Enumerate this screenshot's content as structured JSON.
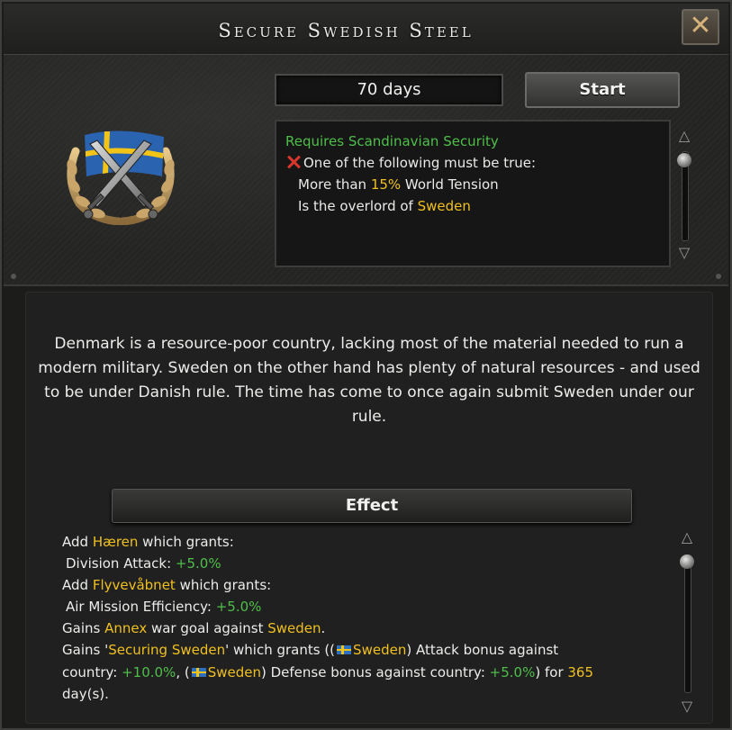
{
  "window": {
    "title": "Secure Swedish Steel",
    "close_icon": "close-x-icon",
    "close_glyph": "✕"
  },
  "focus": {
    "duration": "70 days",
    "start_label": "Start",
    "emblem_icon": "swedish-flag-crossed-swords-emblem"
  },
  "requirements": {
    "title": "Requires Scandinavian Security",
    "condition_label": "One of the following must be true:",
    "option1_prefix": "More than ",
    "option1_value": "15%",
    "option1_suffix": " World Tension",
    "option2_prefix": "Is the overlord of ",
    "option2_country": "Sweden"
  },
  "description": "Denmark is a resource-poor country, lacking most of the material needed to run a modern military. Sweden on the other hand has plenty of natural resources - and used to be under Danish rule. The time has come to once again submit Sweden under our rule.",
  "effect": {
    "header": "Effect",
    "line1_prefix": "Add ",
    "line1_name": "Hæren",
    "line1_suffix": " which grants:",
    "line2_label": "Division Attack: ",
    "line2_value": "+5.0%",
    "line3_prefix": "Add ",
    "line3_name": "Flyvevåbnet",
    "line3_suffix": " which grants:",
    "line4_label": "Air Mission Efficiency: ",
    "line4_value": "+5.0%",
    "line5_prefix": "Gains ",
    "line5_goal": "Annex",
    "line5_mid": " war goal against ",
    "line5_country": "Sweden",
    "line5_end": ".",
    "line6_prefix": "Gains '",
    "line6_name": "Securing Sweden",
    "line6_mid": "' which grants ((",
    "line6_country": "Sweden",
    "line6_suffix": ") Attack bonus against",
    "line7_prefix": "country: ",
    "line7_value1": "+10.0%",
    "line7_mid": ", (",
    "line7_country": "Sweden",
    "line7_mid2": ") Defense bonus against country: ",
    "line7_value2": "+5.0%",
    "line7_mid3": ") for ",
    "line7_days": "365",
    "line8": "day(s)."
  },
  "colors": {
    "highlight_yellow": "#f0c020",
    "positive_green": "#4fbf4a",
    "negative_red": "#d9362c"
  }
}
